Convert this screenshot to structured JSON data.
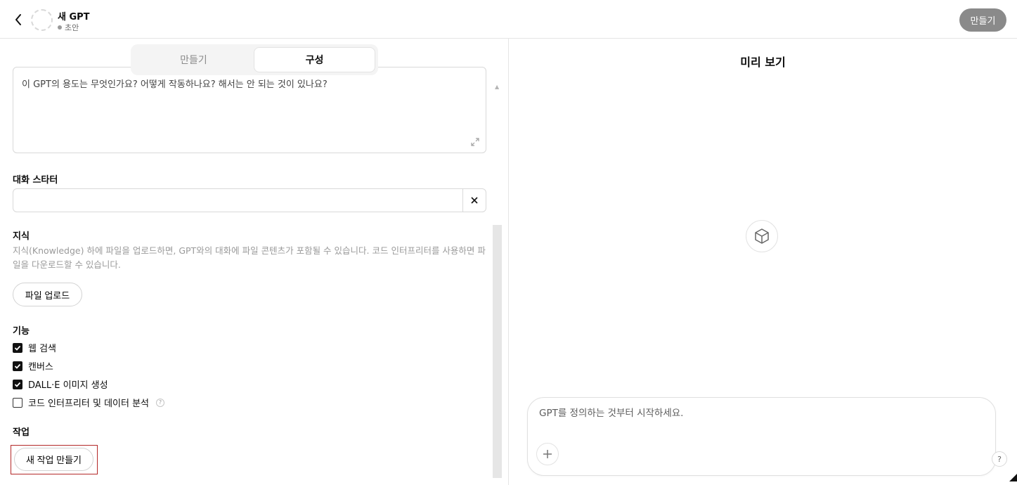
{
  "header": {
    "gpt_name": "새 GPT",
    "gpt_status": "초안",
    "create_label": "만들기"
  },
  "tabs": [
    {
      "label": "만들기",
      "active": false
    },
    {
      "label": "구성",
      "active": true
    }
  ],
  "instructions": {
    "partial_text": "이 GPT의 용도는 무엇인가요? 어떻게 작동하나요? 해서는 안 되는 것이 있나요?"
  },
  "conversation_starters": {
    "label": "대화 스타터",
    "value": ""
  },
  "knowledge": {
    "label": "지식",
    "description": "지식(Knowledge) 하에 파일을 업로드하면, GPT와의 대화에 파일 콘텐츠가 포함될 수 있습니다. 코드 인터프리터를 사용하면 파일을 다운로드할 수 있습니다.",
    "upload_label": "파일 업로드"
  },
  "capabilities": {
    "label": "기능",
    "items": [
      {
        "label": "웹 검색",
        "checked": true
      },
      {
        "label": "캔버스",
        "checked": true
      },
      {
        "label": "DALL·E 이미지 생성",
        "checked": true
      },
      {
        "label": "코드 인터프리터 및 데이터 분석",
        "checked": false
      }
    ]
  },
  "actions": {
    "label": "작업",
    "new_action_label": "새 작업 만들기"
  },
  "preview": {
    "title": "미리 보기",
    "composer_placeholder": "GPT를 정의하는 것부터 시작하세요.",
    "help_label": "?"
  }
}
